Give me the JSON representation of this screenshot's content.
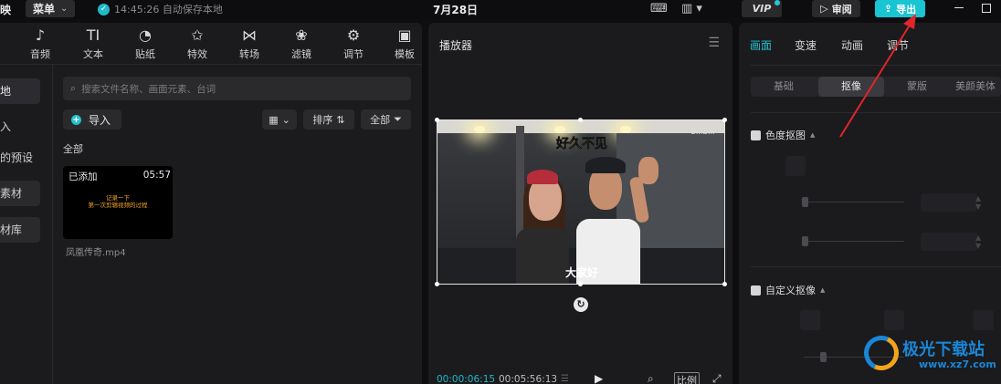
{
  "topbar": {
    "app_fragment": "映",
    "menu_label": "菜单",
    "autosave_text": "14:45:26 自动保存本地",
    "date": "7月28日",
    "vip_label": "VIP",
    "review_label": "审阅",
    "export_label": "导出"
  },
  "toolbar": {
    "items": [
      {
        "label": "音频",
        "icon": "music-note-icon",
        "glyph": "♪"
      },
      {
        "label": "文本",
        "icon": "text-icon",
        "glyph": "TI"
      },
      {
        "label": "贴纸",
        "icon": "sticker-icon",
        "glyph": "◔"
      },
      {
        "label": "特效",
        "icon": "effects-star-icon",
        "glyph": "✩"
      },
      {
        "label": "转场",
        "icon": "transition-icon",
        "glyph": "⋈"
      },
      {
        "label": "滤镜",
        "icon": "filter-icon",
        "glyph": "❀"
      },
      {
        "label": "调节",
        "icon": "adjust-sliders-icon",
        "glyph": "⚙"
      },
      {
        "label": "模板",
        "icon": "template-icon",
        "glyph": "▣"
      }
    ]
  },
  "media_sidebar": {
    "items": [
      "地",
      "入",
      "的预设",
      "素材",
      "材库"
    ]
  },
  "media": {
    "search_placeholder": "搜索文件名称、画面元素、台词",
    "import_label": "导入",
    "sort_label": "排序",
    "filter_label": "全部",
    "section_label": "全部",
    "clip": {
      "added_label": "已添加",
      "duration": "05:57",
      "subtitle_line1": "记录一下",
      "subtitle_line2": "第一次剪辑视频的过程",
      "filename": "凤凰传奇.mp4"
    }
  },
  "player": {
    "title": "播放器",
    "subtitle_top": "好久不见",
    "subtitle_bottom": "大家好",
    "watermark_text": "bilibili",
    "current_time": "00:00:06:15",
    "total_time": "00:05:56:13",
    "ratio_label": "比例"
  },
  "inspector": {
    "tabs": [
      "画面",
      "变速",
      "动画",
      "调节"
    ],
    "subtabs": [
      "基础",
      "抠像",
      "蒙版",
      "美颜美体"
    ],
    "chroma_key_label": "色度抠图",
    "custom_cutout_label": "自定义抠像"
  },
  "watermark": {
    "line1": "极光下载站",
    "line2": "www.xz7.com"
  },
  "colors": {
    "accent": "#22c1cf",
    "annotation_arrow": "#e0252b"
  }
}
